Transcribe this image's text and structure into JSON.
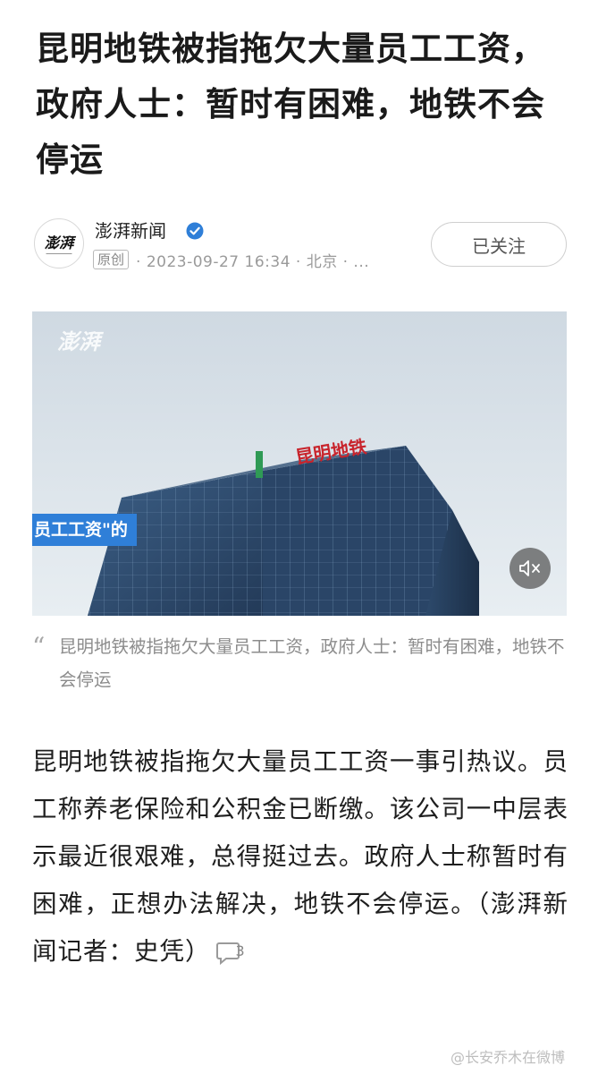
{
  "article": {
    "title": "昆明地铁被指拖欠大量员工工资，政府人士：暂时有困难，地铁不会停运"
  },
  "author": {
    "source_name": "澎湃新闻",
    "avatar_text": "澎湃",
    "original_badge": "原创",
    "meta": "· 2023-09-27 16:34 · 北京 · ...",
    "follow_label": "已关注",
    "verified_icon": "verified-check-icon"
  },
  "video": {
    "watermark": "澎湃",
    "overlay_label": "员工工资\"的",
    "mute_icon": "mute-icon",
    "building_sign": "昆明地铁"
  },
  "caption": {
    "quote_mark": "“",
    "text": "昆明地铁被指拖欠大量员工工资，政府人士：暂时有困难，地铁不会停运"
  },
  "body": {
    "text": "昆明地铁被指拖欠大量员工工资一事引热议。员工称养老保险和公积金已断缴。该公司一中层表示最近很艰难，总得挺过去。政府人士称暂时有困难，正想办法解决，地铁不会停运。（澎湃新闻记者：史凭）",
    "comment_count": "3"
  },
  "footer": {
    "weibo_watermark": "@长安乔木在微博"
  }
}
